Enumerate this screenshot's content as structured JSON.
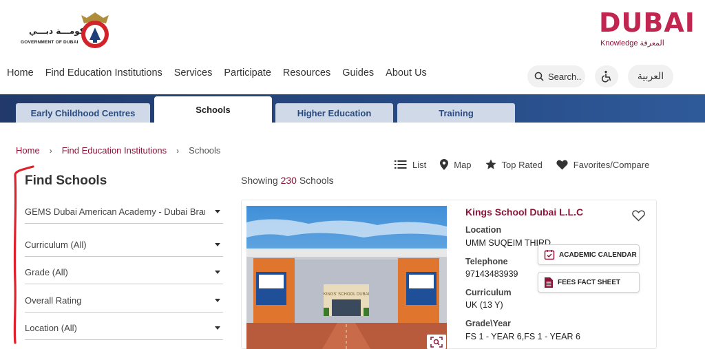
{
  "header": {
    "gov_text_ar": "حكومـــة دبـــي",
    "gov_text_en": "GOVERNMENT OF DUBAI",
    "brand_word": "DUBAI",
    "brand_sub": "Knowledge المعرفة"
  },
  "nav": {
    "items": [
      "Home",
      "Find Education Institutions",
      "Services",
      "Participate",
      "Resources",
      "Guides",
      "About Us"
    ],
    "search_label": "Search..",
    "lang_label": "العربية"
  },
  "tabs": [
    {
      "label": "Early Childhood Centres",
      "active": false
    },
    {
      "label": "Schools",
      "active": true
    },
    {
      "label": "Higher Education",
      "active": false
    },
    {
      "label": "Training",
      "active": false
    }
  ],
  "breadcrumb": {
    "items": [
      "Home",
      "Find Education Institutions",
      "Schools"
    ]
  },
  "view_options": {
    "list": "List",
    "map": "Map",
    "top_rated": "Top Rated",
    "favorites": "Favorites/Compare"
  },
  "filters": {
    "title": "Find Schools",
    "school_value": "GEMS Dubai American Academy - Dubai Branch",
    "curriculum": "Curriculum (All)",
    "grade": "Grade (All)",
    "rating": "Overall Rating",
    "location": "Location (All)"
  },
  "results": {
    "prefix": "Showing",
    "count": "230",
    "suffix": "Schools"
  },
  "school_card": {
    "name": "Kings School Dubai L.L.C",
    "location_label": "Location",
    "location": "UMM SUQEIM THIRD",
    "telephone_label": "Telephone",
    "telephone": "97143483939",
    "curriculum_label": "Curriculum",
    "curriculum": "UK (13 Y)",
    "grade_label": "Grade\\Year",
    "grade": "FS 1 - YEAR 6,FS 1 - YEAR 6",
    "academic_calendar_label": "ACADEMIC CALENDAR",
    "fees_label": "FEES FACT SHEET",
    "photo_sign": "KINGS' SCHOOL DUBAI"
  },
  "colors": {
    "brand": "#8a1538",
    "dubai_logo": "#c0264f",
    "band": "#274b85",
    "annotation": "#e0202a"
  }
}
